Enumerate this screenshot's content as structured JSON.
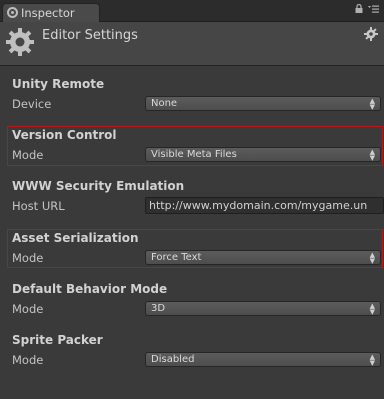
{
  "tabbar": {
    "tab_label": "Inspector",
    "tools": "🔒 ▾≡"
  },
  "header": {
    "title": "Editor Settings"
  },
  "sections": {
    "unity_remote": {
      "title": "Unity Remote",
      "label": "Device",
      "value": "None"
    },
    "version_control": {
      "title": "Version Control",
      "label": "Mode",
      "value": "Visible Meta Files"
    },
    "www_security": {
      "title": "WWW Security Emulation",
      "label": "Host URL",
      "value": "http://www.mydomain.com/mygame.un"
    },
    "asset_serialization": {
      "title": "Asset Serialization",
      "label": "Mode",
      "value": "Force Text"
    },
    "default_behavior": {
      "title": "Default Behavior Mode",
      "label": "Mode",
      "value": "3D"
    },
    "sprite_packer": {
      "title": "Sprite Packer",
      "label": "Mode",
      "value": "Disabled"
    }
  },
  "colors": {
    "background": "#3a3a3a",
    "highlight": "#b51818"
  }
}
